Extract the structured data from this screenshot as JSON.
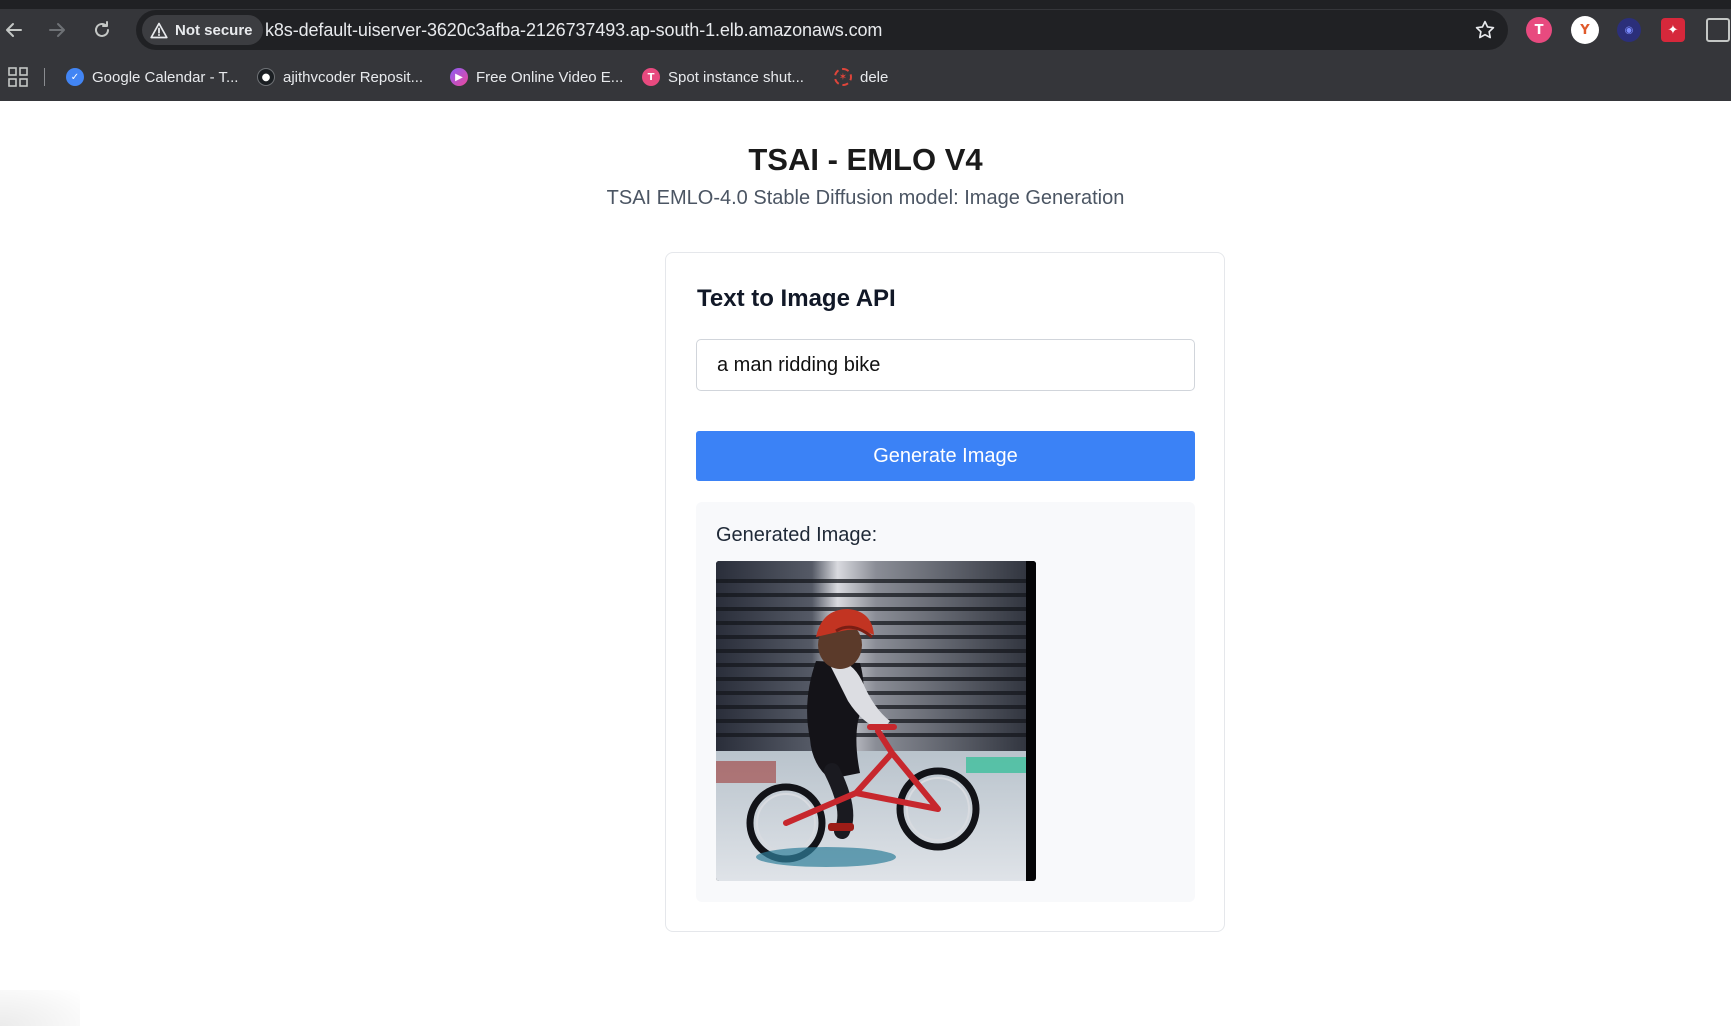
{
  "browser": {
    "security_label": "Not secure",
    "url": "k8s-default-uiserver-3620c3afba-2126737493.ap-south-1.elb.amazonaws.com",
    "bookmarks": [
      {
        "label": "Google Calendar - T...",
        "icon": "google-calendar-icon"
      },
      {
        "label": "ajithvcoder Reposit...",
        "icon": "github-icon"
      },
      {
        "label": "Free Online Video E...",
        "icon": "video-editor-icon"
      },
      {
        "label": "Spot instance shut...",
        "icon": "spot-icon"
      },
      {
        "label": "dele",
        "icon": "dele-icon"
      }
    ]
  },
  "header": {
    "title": "TSAI - EMLO V4",
    "subtitle": "TSAI EMLO-4.0 Stable Diffusion model: Image Generation"
  },
  "form": {
    "title": "Text to Image API",
    "prompt_value": "a man ridding bike",
    "button_label": "Generate Image"
  },
  "result": {
    "label": "Generated Image:"
  },
  "colors": {
    "accent": "#3b82f6",
    "chrome_bg": "#35363a"
  }
}
